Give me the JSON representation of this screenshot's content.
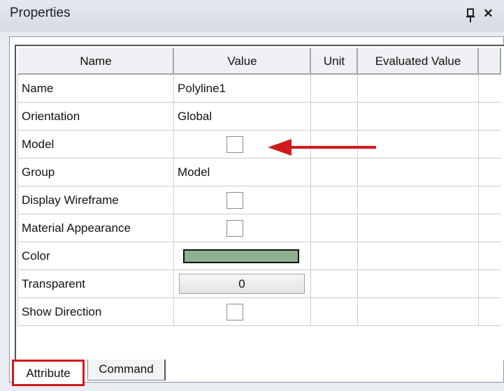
{
  "window": {
    "title": "Properties",
    "pin_icon": "pin-icon",
    "close_label": "×"
  },
  "table": {
    "headers": [
      "Name",
      "Value",
      "Unit",
      "Evaluated Value"
    ],
    "rows": [
      {
        "name": "Name",
        "type": "text",
        "value": "Polyline1"
      },
      {
        "name": "Orientation",
        "type": "text",
        "value": "Global"
      },
      {
        "name": "Model",
        "type": "checkbox",
        "checked": false
      },
      {
        "name": "Group",
        "type": "text",
        "value": "Model"
      },
      {
        "name": "Display Wireframe",
        "type": "checkbox",
        "checked": false
      },
      {
        "name": "Material Appearance",
        "type": "checkbox",
        "checked": false
      },
      {
        "name": "Color",
        "type": "color",
        "color": "#8eb08e"
      },
      {
        "name": "Transparent",
        "type": "number",
        "value": "0"
      },
      {
        "name": "Show Direction",
        "type": "checkbox",
        "checked": false
      }
    ]
  },
  "annotation": {
    "arrow_icon": "red-arrow-icon",
    "arrow_color": "#d01a1a"
  },
  "tabs": {
    "attribute": "Attribute",
    "command": "Command",
    "highlight_color": "#d01a1a"
  }
}
